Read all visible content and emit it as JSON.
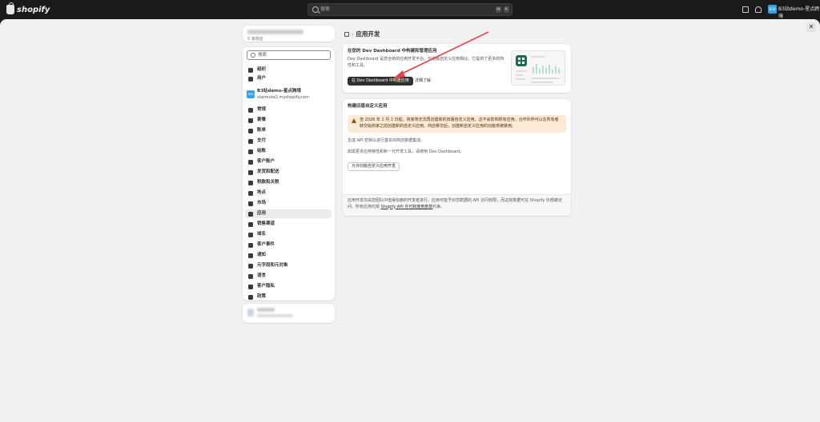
{
  "topbar": {
    "logo_text": "shopify",
    "search_placeholder": "搜索",
    "kbd1": "⌘",
    "kbd2": "K",
    "store_name": "B3站demo-星点跨境",
    "avatar_initials": "B3S"
  },
  "sidebar": {
    "top_subtitle": "5 家商店",
    "search_placeholder": "搜索",
    "org_items": [
      {
        "label": "组织"
      },
      {
        "label": "用户"
      }
    ],
    "store": {
      "initials": "B3S",
      "title": "B3站demo-星点跨境",
      "domain": "starroute3.myshopify.com"
    },
    "items": [
      {
        "label": "常规"
      },
      {
        "label": "套餐"
      },
      {
        "label": "账单"
      },
      {
        "label": "支付"
      },
      {
        "label": "结账"
      },
      {
        "label": "客户账户"
      },
      {
        "label": "发货和配送"
      },
      {
        "label": "税款和关税"
      },
      {
        "label": "地点"
      },
      {
        "label": "市场"
      },
      {
        "label": "应用"
      },
      {
        "label": "销售渠道"
      },
      {
        "label": "域名"
      },
      {
        "label": "客户事件"
      },
      {
        "label": "通知"
      },
      {
        "label": "元字段和元对象"
      },
      {
        "label": "语言"
      },
      {
        "label": "客户隐私"
      },
      {
        "label": "政策"
      }
    ],
    "active_item": "应用"
  },
  "content": {
    "breadcrumb_title": "应用开发",
    "card1": {
      "title": "在您的 Dev Dashboard 中构建和管理应用",
      "text": "Dev Dashboard 是您全新的应用开发平台。与旧版自定义应用相比，它提供了更多的特性和工具。",
      "primary_button": "在 Dev Dashboard 中构建应用",
      "link_button": "详细了解"
    },
    "card2": {
      "title": "构建旧版自定义应用",
      "warning": "自 2026 年 1 月 1 日起，商家将无法再创建新的旧版自定义应用。这不会影响现有应用。合作伙伴可以在所有者转交给商家之前创建新的自定义应用。商店移交后，创建新自定义应用的功能将被禁用。",
      "text1": "生成 API 密钥以进行基本的商店数据集成。",
      "text2": "如需更多应用特性和新一代开发工具，请使用 Dev Dashboard。",
      "button": "允许旧版自定义应用开发",
      "footer_text": "应用开发仅由您团队中值得信赖的开发者进行。应用可能予对您数据的 API 访问权限，而这些数据可在 Shopify 外部被访问。所有应用均受",
      "footer_link": "Shopify API 许可和使用条款",
      "footer_end": "约束。"
    }
  },
  "annotation": {
    "arrow_color": "#e8434a"
  }
}
